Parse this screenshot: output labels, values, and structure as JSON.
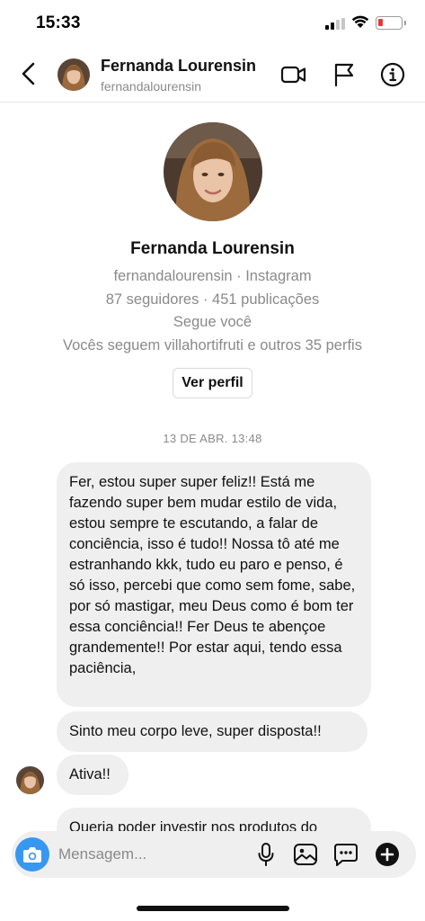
{
  "status_bar": {
    "time": "15:33",
    "icons": [
      "signal-icon",
      "wifi-icon",
      "battery-low-icon"
    ],
    "battery_color": "#e53935"
  },
  "header": {
    "name": "Fernanda Lourensin",
    "username": "fernandalourensin",
    "icons": [
      "back-arrow-icon",
      "avatar",
      "video-call-icon",
      "flag-icon",
      "info-icon"
    ]
  },
  "profile": {
    "name": "Fernanda Lourensin",
    "source_line": "fernandalourensin · Instagram",
    "stats_line": "87 seguidores · 451 publicações",
    "follow_status": "Segue você",
    "mutuals_line": "Vocês seguem villahortifruti e outros 35 perfis",
    "view_profile_label": "Ver perfil"
  },
  "conversation": {
    "timestamp": "13 DE ABR. 13:48",
    "messages": [
      {
        "text": "Fer, estou super super feliz!! Está me fazendo super bem mudar estilo de vida, estou sempre te escutando, a falar de conciência, isso é tudo!! Nossa tô até me estranhando kkk, tudo eu paro e penso, é só isso, percebi que como sem fome, sabe, por só mastigar, meu Deus  como é bom ter essa conciência!! Fer  Deus te abençoe grandemente!! Por estar aqui, tendo essa paciência,"
      },
      {
        "text": "Sinto meu corpo leve, super disposta!!"
      },
      {
        "text": "Ativa!!"
      },
      {
        "text": "Queria poder investir nos produtos do"
      }
    ]
  },
  "composer": {
    "placeholder": "Mensagem...",
    "icons": [
      "camera-icon",
      "microphone-icon",
      "gallery-icon",
      "sticker-icon",
      "plus-icon"
    ],
    "accent_color": "#3897f0"
  }
}
